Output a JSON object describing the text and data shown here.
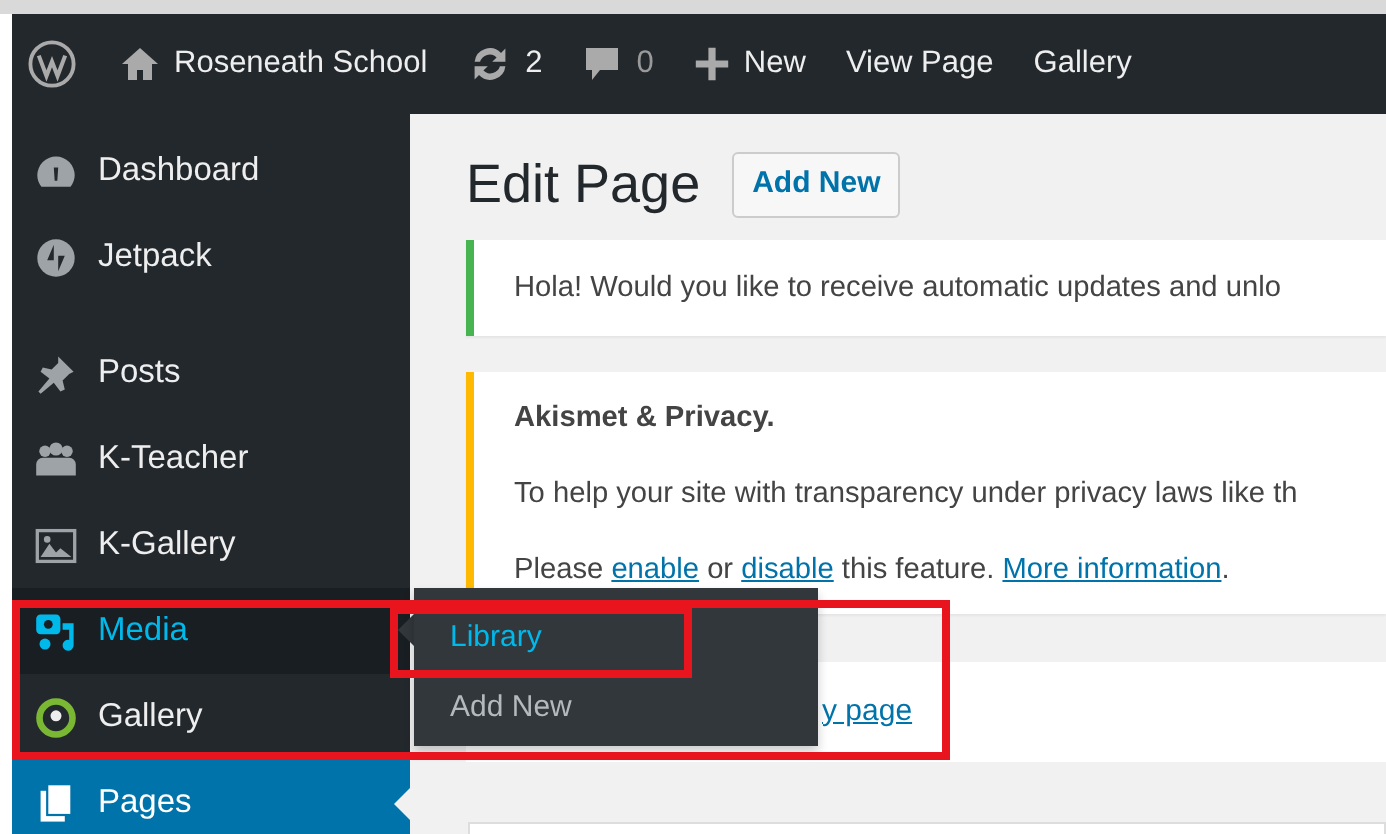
{
  "admin_bar": {
    "site_name": "Roseneath School",
    "updates_count": "2",
    "comments_count": "0",
    "new_label": "New",
    "links": [
      "View Page",
      "Gallery"
    ]
  },
  "sidebar": {
    "items": [
      {
        "kind": "item",
        "label": "Dashboard",
        "selected": false,
        "current": false
      },
      {
        "kind": "item",
        "label": "Jetpack",
        "selected": false,
        "current": false
      },
      {
        "kind": "separator"
      },
      {
        "kind": "item",
        "label": "Posts",
        "selected": false,
        "current": false
      },
      {
        "kind": "item",
        "label": "K-Teacher",
        "selected": false,
        "current": false
      },
      {
        "kind": "item",
        "label": "K-Gallery",
        "selected": false,
        "current": false
      },
      {
        "kind": "item",
        "label": "Media",
        "selected": true,
        "current": false
      },
      {
        "kind": "item",
        "label": "Gallery",
        "selected": false,
        "current": false
      },
      {
        "kind": "item",
        "label": "Pages",
        "selected": false,
        "current": true
      }
    ]
  },
  "flyout": {
    "items": [
      {
        "label": "Library",
        "selected": true
      },
      {
        "label": "Add New",
        "selected": false
      }
    ]
  },
  "page": {
    "title": "Edit Page",
    "add_new_button": "Add New",
    "notices": [
      {
        "kind": "success",
        "lines": [
          [
            {
              "text": "Hola! Would you like to receive automatic updates and unlo",
              "link": false
            }
          ]
        ]
      },
      {
        "kind": "warning",
        "title": "Akismet & Privacy.",
        "lines": [
          [
            {
              "text": "To help your site with transparency under privacy laws like th",
              "link": false
            }
          ],
          [
            {
              "text": "Please ",
              "link": false
            },
            {
              "text": "enable",
              "link": true
            },
            {
              "text": " or ",
              "link": false
            },
            {
              "text": "disable",
              "link": true
            },
            {
              "text": " this feature. ",
              "link": false
            },
            {
              "text": "More information",
              "link": true
            },
            {
              "text": ".",
              "link": false
            }
          ]
        ]
      }
    ],
    "view_link": "y page"
  }
}
